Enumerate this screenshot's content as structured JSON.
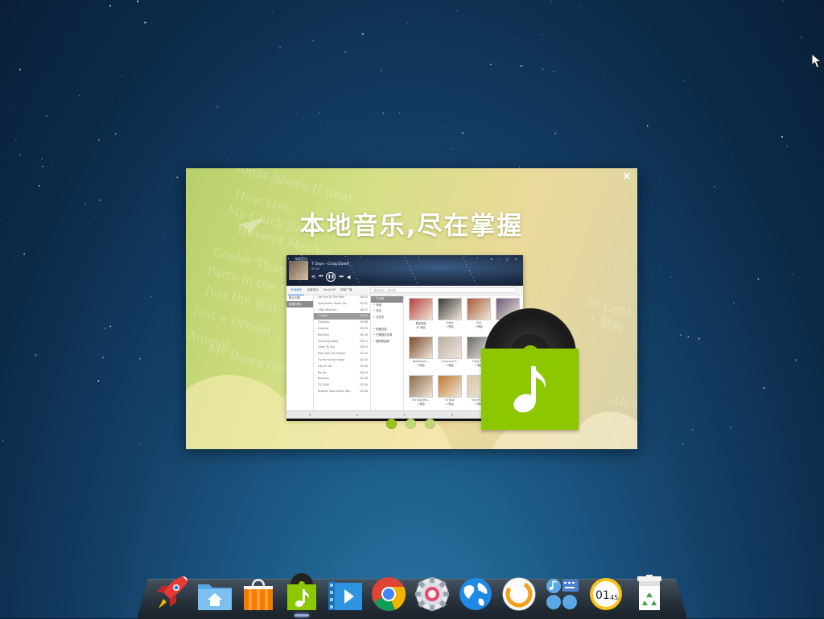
{
  "dialog": {
    "headline": "本地音乐,尽在掌握",
    "close_label": "×",
    "background_words": [
      "Right Above It (feat.",
      "How Low",
      "My Chick Bad",
      "Haven't Met Yet",
      "Cooler Than Me",
      "Party in the U.S.A",
      "Just the Way You",
      "Just a Dream",
      "Animal",
      "Mr Down (feat.",
      "50 Cent",
      "1 歌曲",
      "Alici"
    ],
    "slides": {
      "count": 3,
      "active_index": 0
    }
  },
  "app": {
    "name": "深度音乐",
    "song": "7 Days - Craig David",
    "time": "00:05",
    "tabs": [
      "本地音乐",
      "百度音乐",
      "MusicFM",
      "网络广播"
    ],
    "active_tab": 0,
    "search_placeholder": "搜索音乐、歌词等",
    "side_items": [
      "默认列表",
      "新建列表1"
    ],
    "side_selected": 1,
    "songs": [
      {
        "title": "Set Fire To The Rain",
        "dur": "04:03"
      },
      {
        "title": "Symphonic Poem Ge...",
        "dur": "05:42"
      },
      {
        "title": "I Will Miss You",
        "dur": "04:07"
      },
      {
        "title": "7 Days",
        "dur": "03:55"
      },
      {
        "title": "Galaxya",
        "dur": "03:48"
      },
      {
        "title": "Cosmos",
        "dur": "06:09"
      },
      {
        "title": "Bye Bye",
        "dur": "04:26"
      },
      {
        "title": "Touch My Body",
        "dur": "03:24"
      },
      {
        "title": "Close To You",
        "dur": "04:03"
      },
      {
        "title": "Mad with the Flower",
        "dur": "02:44"
      },
      {
        "title": "Fly me to the moon",
        "dur": "01:55"
      },
      {
        "title": "Like A Gift",
        "dur": "03:36"
      },
      {
        "title": "No Air",
        "dur": "04:24"
      },
      {
        "title": "Kalimba",
        "dur": "05:48"
      },
      {
        "title": "TS-2000",
        "dur": "03:29"
      },
      {
        "title": "Autumn Dew Scent (Re...",
        "dur": "03:46"
      }
    ],
    "selected_song": 3,
    "categories": [
      "艺术家",
      "专辑",
      "流派",
      "文件夹",
      "",
      "快速扫描",
      "扫描指定目录",
      "删除歌曲库"
    ],
    "selected_category": 0,
    "artists": [
      {
        "name": "群星歌曲",
        "count": "42 歌曲",
        "color": "#b5403a"
      },
      {
        "name": "Adele",
        "count": "1 歌曲",
        "color": "#3a3a3a"
      },
      {
        "name": "Alia",
        "count": "1 歌曲",
        "color": "#a55a3a"
      },
      {
        "name": "",
        "count": "",
        "color": "#6a5a7a"
      },
      {
        "name": "Beethoven...",
        "count": "1 歌曲",
        "color": "#7a4a2a"
      },
      {
        "name": "Claricque P...",
        "count": "1 歌曲",
        "color": "#b9b0a5"
      },
      {
        "name": "Craig Da...",
        "count": "1 歌曲",
        "color": "#6a6a6a"
      },
      {
        "name": "",
        "count": "",
        "color": "#c0b090"
      },
      {
        "name": "Far East Mo...",
        "count": "1 歌曲",
        "color": "#8a6a4a"
      },
      {
        "name": "Fo Rolo",
        "count": "1 歌曲",
        "color": "#c07a30"
      },
      {
        "name": "Fort Mino...",
        "count": "1 歌曲",
        "color": "#d8c8a8"
      },
      {
        "name": "",
        "count": "",
        "color": "#ffffff"
      }
    ],
    "bottom_icons": [
      "search-icon",
      "list-icon",
      "add-icon",
      "shuffle-icon",
      "delete-icon"
    ]
  },
  "dock": {
    "items": [
      {
        "name": "launcher",
        "icon": "rocket-icon"
      },
      {
        "name": "file-manager",
        "icon": "home-folder-icon"
      },
      {
        "name": "software-center",
        "icon": "shopping-bag-icon"
      },
      {
        "name": "music-player",
        "icon": "music-note-icon",
        "running": true
      },
      {
        "name": "video-player",
        "icon": "film-play-icon"
      },
      {
        "name": "chrome",
        "icon": "chrome-icon"
      },
      {
        "name": "system-settings",
        "icon": "gear-icon"
      },
      {
        "name": "browser",
        "icon": "globe-icon"
      },
      {
        "name": "system-monitor",
        "icon": "ring-gauge-icon"
      },
      {
        "name": "input-settings",
        "icon": "keyboard-apps-icon"
      },
      {
        "name": "clock",
        "icon": "clock-icon",
        "clock_text_hour": "01",
        "clock_text_min": "45"
      },
      {
        "name": "trash",
        "icon": "trash-icon"
      }
    ]
  },
  "colors": {
    "accent_green": "#8cc700",
    "dock_dark": "#27323c"
  }
}
